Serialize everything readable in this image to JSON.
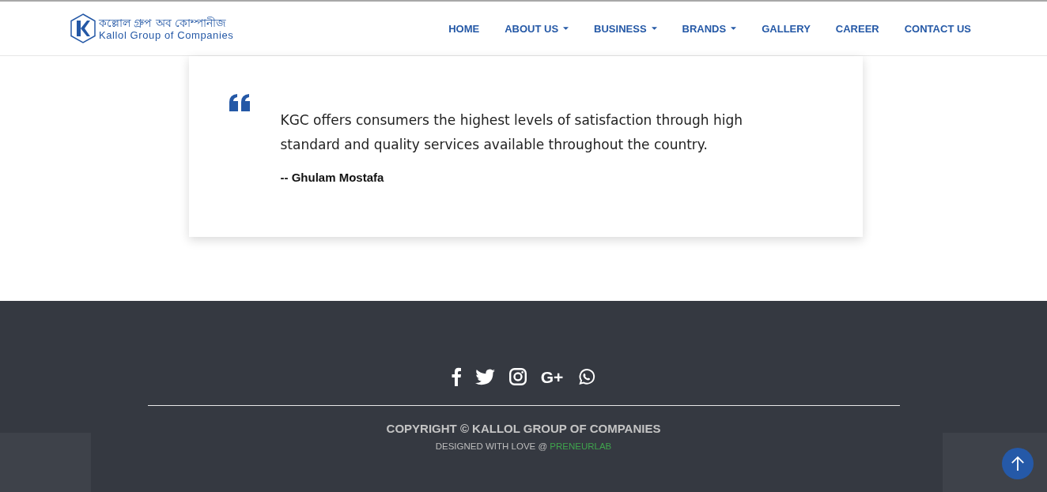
{
  "logo": {
    "bengali": "কল্লোল গ্রুপ অব কোম্পানীজ",
    "english": "Kallol Group of Companies"
  },
  "nav": [
    {
      "label": "HOME",
      "dropdown": false
    },
    {
      "label": "ABOUT US",
      "dropdown": true
    },
    {
      "label": "BUSINESS",
      "dropdown": true
    },
    {
      "label": "BRANDS",
      "dropdown": true
    },
    {
      "label": "GALLERY",
      "dropdown": false
    },
    {
      "label": "CAREER",
      "dropdown": false
    },
    {
      "label": "CONTACT US",
      "dropdown": false
    }
  ],
  "quote": {
    "text": "KGC offers consumers the highest levels of satisfaction through high standard and quality services available throughout the country.",
    "author": "-- Ghulam Mostafa"
  },
  "footer": {
    "social": [
      {
        "kind": "facebook"
      },
      {
        "kind": "twitter"
      },
      {
        "kind": "instagram"
      },
      {
        "kind": "googleplus",
        "label": "G+"
      },
      {
        "kind": "whatsapp"
      }
    ],
    "copyright": "COPYRIGHT © KALLOL GROUP OF COMPANIES",
    "designed": "DESIGNED WITH LOVE @ ",
    "designer": "PRENEURLAB"
  }
}
